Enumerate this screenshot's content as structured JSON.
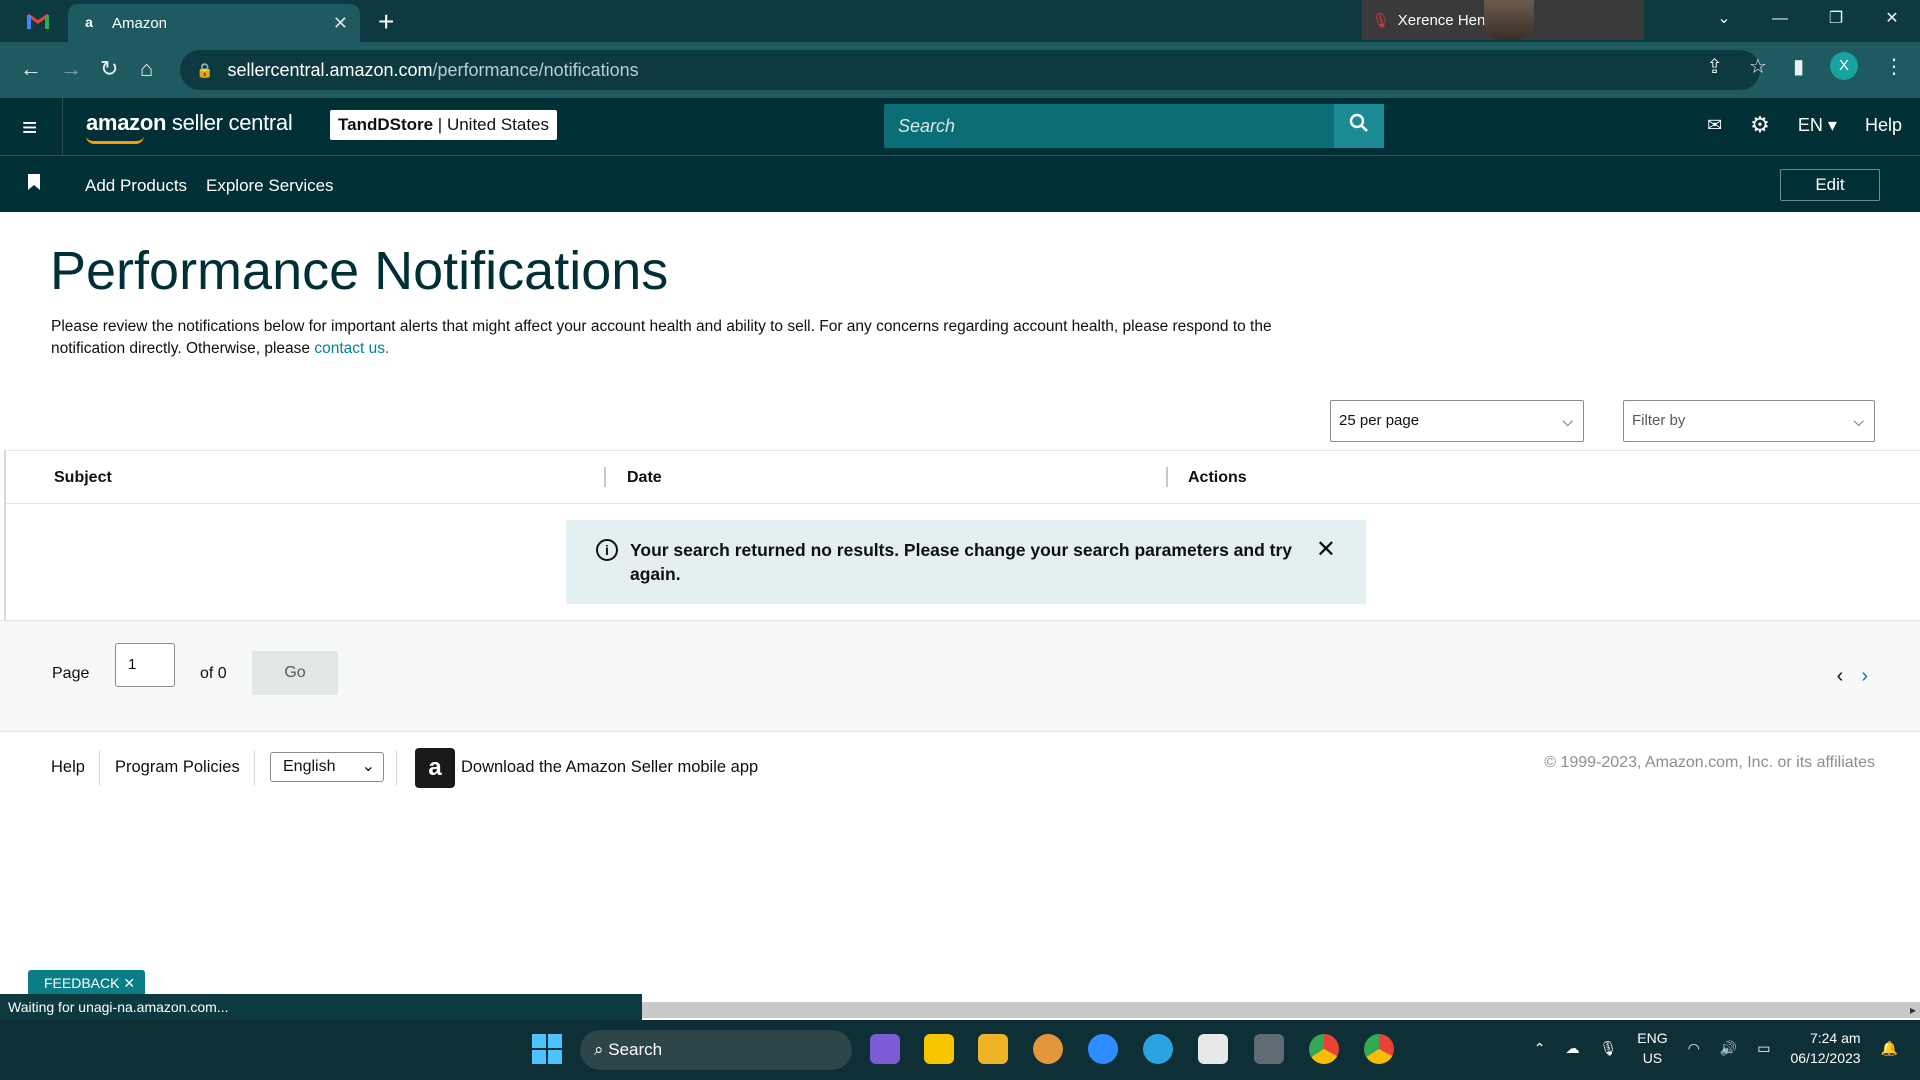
{
  "browser": {
    "tab_title": "Amazon",
    "tab_favicon": "a",
    "url_domain": "sellercentral.amazon.com",
    "url_path": "/performance/notifications",
    "profile_letter": "X",
    "call_name": "Xerence Henry"
  },
  "header": {
    "logo_bold": "amazon",
    "logo_rest": " seller central",
    "store_name": "TandDStore",
    "store_region": "United States",
    "search_placeholder": "Search",
    "language": "EN",
    "help": "Help"
  },
  "subnav": {
    "add_products": "Add Products",
    "explore_services": "Explore Services",
    "edit": "Edit"
  },
  "page": {
    "title": "Performance Notifications",
    "description": "Please review the notifications below for important alerts that might affect your account health and ability to sell. For any concerns regarding account health, please respond to the notification directly. Otherwise, please ",
    "contact_link": "contact us.",
    "per_page": "25 per page",
    "filter_by": "Filter by"
  },
  "table": {
    "columns": [
      "Subject",
      "Date",
      "Actions"
    ],
    "empty_message": "Your search returned no results. Please change your search parameters and try again."
  },
  "pager": {
    "page_label": "Page",
    "page_value": "1",
    "of_label": "of 0",
    "go": "Go"
  },
  "footer": {
    "help": "Help",
    "program_policies": "Program Policies",
    "language": "English",
    "app_text": "Download the Amazon Seller mobile app",
    "copyright": "© 1999-2023, Amazon.com, Inc. or its affiliates"
  },
  "overlay": {
    "feedback": "FEEDBACK",
    "status": "Waiting for unagi-na.amazon.com..."
  },
  "taskbar": {
    "search": "Search",
    "lang_top": "ENG",
    "lang_bottom": "US",
    "time": "7:24 am",
    "date": "06/12/2023"
  }
}
